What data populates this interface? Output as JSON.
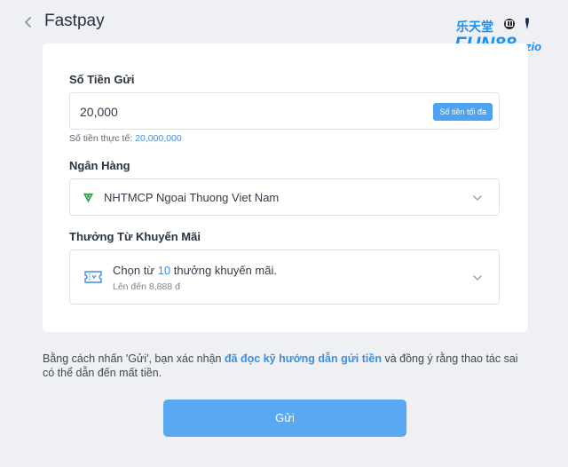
{
  "header": {
    "title": "Fastpay",
    "logo_text": "FUN88",
    "logo_suffix": "zio",
    "logo_top_text": "乐天堂"
  },
  "form": {
    "amount_label": "Số Tiền Gửi",
    "amount_value": "20,000",
    "max_button": "Số tiền tối đa",
    "actual_label": "Số tiền thực tế:",
    "actual_value": "20,000,000",
    "bank_label": "Ngân Hàng",
    "bank_value": "NHTMCP Ngoai Thuong Viet Nam",
    "promo_label": "Thưởng Từ Khuyến Mãi",
    "promo_prefix": "Chọn từ",
    "promo_count": "10",
    "promo_suffix": "thưởng khuyến mãi.",
    "promo_sub": "Lên đến 8,888 đ"
  },
  "terms": {
    "prefix": "Bằng cách nhấn 'Gửi', bạn xác nhận",
    "link": "đã đọc kỹ hướng dẫn gửi tiền",
    "suffix": "và đồng ý rằng thao tác sai có thể dẫn đến mất tiền."
  },
  "submit_label": "Gửi",
  "colors": {
    "accent": "#3d8fe0",
    "button": "#5aa8f2",
    "background": "#eef0f4"
  }
}
